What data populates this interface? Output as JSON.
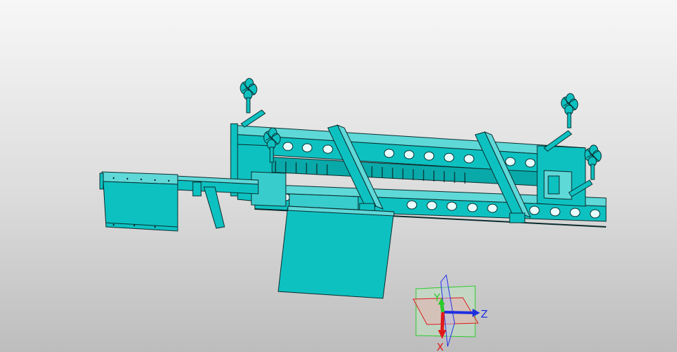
{
  "viewport": {
    "model_color": "#0ec1c1",
    "outline_color": "#0a2a2a",
    "background_top": "#f7f7f7",
    "background_bottom": "#bdbdbd"
  },
  "triad": {
    "x_label": "X",
    "y_label": "Y",
    "z_label": "Z",
    "x_color": "#e01a1a",
    "y_color": "#2cc92c",
    "z_color": "#1f2fe0"
  }
}
